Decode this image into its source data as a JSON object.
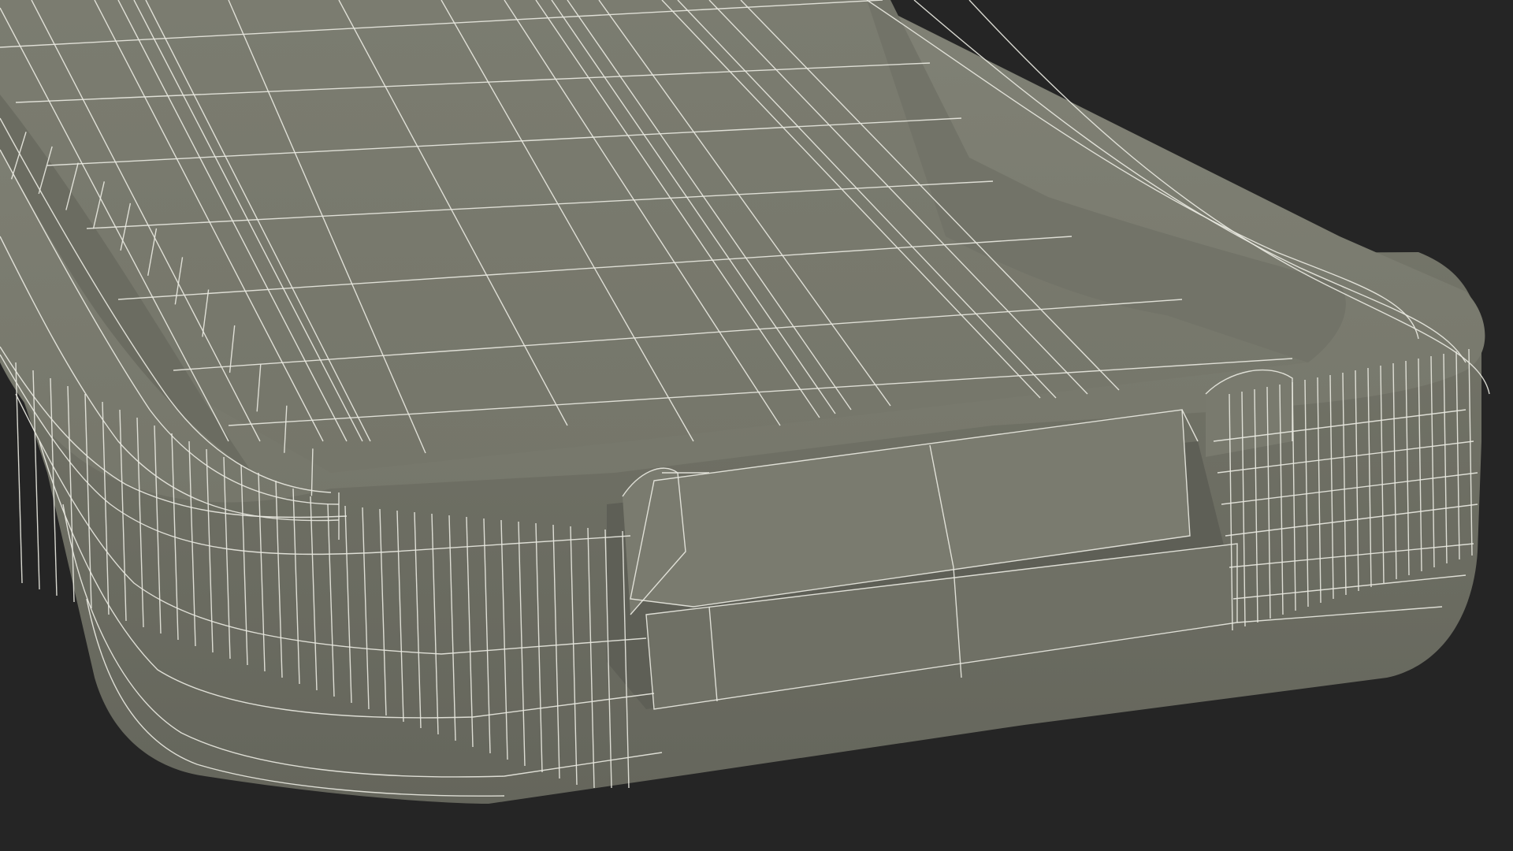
{
  "scene": {
    "subject": "phone-case-mesh",
    "colors": {
      "background": "#252525",
      "surface_top": "#7d7e72",
      "surface_inner": "#747569",
      "surface_side": "#6c6d62",
      "surface_shadow": "#5e5f56",
      "wire": "#e8e8e0"
    }
  }
}
